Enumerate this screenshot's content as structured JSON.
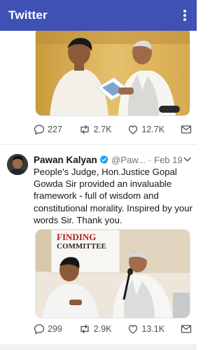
{
  "app_bar": {
    "title": "Twitter",
    "overflow_icon": "more-vert-icon"
  },
  "tweets": [
    {
      "media_description_icon": "photo",
      "actions": {
        "replies": "227",
        "retweets": "2.7K",
        "likes": "12.7K"
      }
    },
    {
      "author": {
        "name": "Pawan Kalyan",
        "handle": "@Paw...",
        "date": "Feb 19",
        "verified": true
      },
      "text": "People's Judge, Hon.Justice  Gopal Gowda Sir provided an invaluable framework - full of wisdom and constitutional morality. Inspired by your words Sir. Thank you.",
      "media_sign_text": [
        "FINDING",
        "COMMITTEE"
      ],
      "actions": {
        "replies": "299",
        "retweets": "2.9K",
        "likes": "13.1K"
      }
    }
  ],
  "colors": {
    "app_bar": "#3f51b5",
    "icon_grey": "#4a4f55",
    "verified": "#1da1f2"
  }
}
